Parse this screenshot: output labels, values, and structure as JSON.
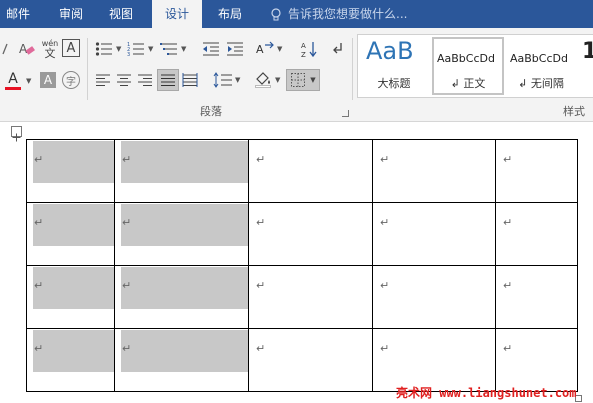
{
  "tabs": [
    {
      "label": "邮件",
      "active": false
    },
    {
      "label": "审阅",
      "active": false
    },
    {
      "label": "视图",
      "active": false
    },
    {
      "label": "设计",
      "active": true
    },
    {
      "label": "布局",
      "active": false
    }
  ],
  "tell_me": {
    "placeholder": "告诉我您想要做什么..."
  },
  "ribbon": {
    "paragraph_group_label": "段落",
    "styles_group_label": "样式",
    "font_tools": {
      "phonetic_guide_label": "wén",
      "phonetic_guide_char": "文",
      "char_border_label": "A",
      "font_color_label": "A",
      "char_shading_label": "A",
      "enclose_char_label": "字",
      "font_color": "#e81123"
    },
    "styles": [
      {
        "sample": "AaB",
        "name": "大标题",
        "current": false
      },
      {
        "sample": "AaBbCcDd",
        "name": "↲ 正文",
        "current": true
      },
      {
        "sample": "AaBbCcDd",
        "name": "↲ 无间隔",
        "current": false
      },
      {
        "sample": "1",
        "name": "",
        "current": false
      }
    ]
  },
  "document": {
    "cell_mark": "↵",
    "table": {
      "rows": 4,
      "columns": 5,
      "shaded_columns": [
        0,
        1
      ]
    }
  },
  "watermark": "亮术网 www.liangshunet.com",
  "colors": {
    "tab_bar": "#2b579a",
    "ribbon_bg": "#f3f3f3",
    "cell_shade": "#c8c8c8",
    "watermark": "#e02020",
    "style_heading": "#2e74b5"
  }
}
